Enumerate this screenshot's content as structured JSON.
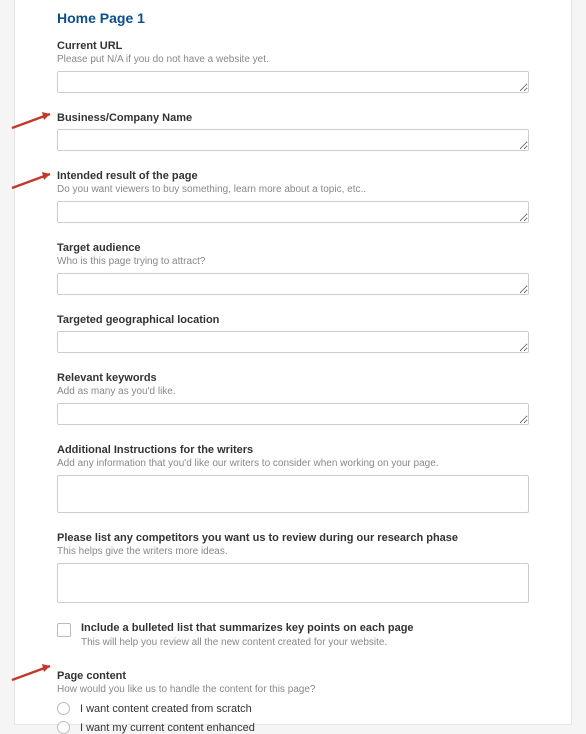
{
  "sectionTitle": "Home Page 1",
  "fields": {
    "currentUrl": {
      "label": "Current URL",
      "hint": "Please put N/A if you do not have a website yet."
    },
    "businessName": {
      "label": "Business/Company Name"
    },
    "intendedResult": {
      "label": "Intended result of the page",
      "hint": "Do you want viewers to buy something, learn more about a topic, etc.."
    },
    "targetAudience": {
      "label": "Target audience",
      "hint": "Who is this page trying to attract?"
    },
    "geoLocation": {
      "label": "Targeted geographical location"
    },
    "keywords": {
      "label": "Relevant keywords",
      "hint": "Add as many as you'd like."
    },
    "additionalInstructions": {
      "label": "Additional Instructions for the writers",
      "hint": "Add any information that you'd like our writers to consider when working on your page."
    },
    "competitors": {
      "label": "Please list any competitors you want us to review during our research phase",
      "hint": "This helps give the writers more ideas."
    }
  },
  "checkbox": {
    "label": "Include a bulleted list that summarizes key points on each page",
    "hint": "This will help you review all the new content created for your website."
  },
  "pageContent": {
    "label": "Page content",
    "hint": "How would you like us to handle the content for this page?",
    "options": [
      "I want content created from scratch",
      "I want my current content enhanced"
    ]
  }
}
